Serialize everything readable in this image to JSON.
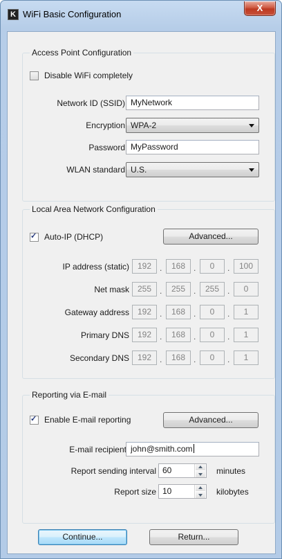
{
  "window": {
    "title": "WiFi Basic Configuration",
    "icon_letter": "K",
    "close_glyph": "X"
  },
  "access_point": {
    "legend": "Access Point Configuration",
    "disable_wifi": {
      "label": "Disable WiFi completely",
      "checked": false
    },
    "ssid": {
      "label": "Network ID (SSID)",
      "value": "MyNetwork"
    },
    "encryption": {
      "label": "Encryption",
      "value": "WPA-2"
    },
    "password": {
      "label": "Password",
      "value": "MyPassword"
    },
    "wlan_standard": {
      "label": "WLAN standard",
      "value": "U.S."
    }
  },
  "lan": {
    "legend": "Local Area Network Configuration",
    "auto_ip": {
      "label": "Auto-IP (DHCP)",
      "checked": true
    },
    "advanced_label": "Advanced...",
    "rows": [
      {
        "label": "IP address (static)",
        "octets": [
          "192",
          "168",
          "0",
          "100"
        ]
      },
      {
        "label": "Net mask",
        "octets": [
          "255",
          "255",
          "255",
          "0"
        ]
      },
      {
        "label": "Gateway address",
        "octets": [
          "192",
          "168",
          "0",
          "1"
        ]
      },
      {
        "label": "Primary DNS",
        "octets": [
          "192",
          "168",
          "0",
          "1"
        ]
      },
      {
        "label": "Secondary DNS",
        "octets": [
          "192",
          "168",
          "0",
          "1"
        ]
      }
    ],
    "separator": "."
  },
  "email": {
    "legend": "Reporting via E-mail",
    "enable": {
      "label": "Enable E-mail reporting",
      "checked": true
    },
    "advanced_label": "Advanced...",
    "recipient": {
      "label": "E-mail recipient",
      "value": "john@smith.com"
    },
    "interval": {
      "label": "Report sending interval",
      "value": "60",
      "unit": "minutes"
    },
    "size": {
      "label": "Report size",
      "value": "10",
      "unit": "kilobytes"
    }
  },
  "footer": {
    "continue_label": "Continue...",
    "return_label": "Return..."
  },
  "colors": {
    "titlebar": "#c7dbf1",
    "close_button": "#c7513a",
    "dialog_bg": "#f0f0f0",
    "default_button": "#bee6fd"
  }
}
